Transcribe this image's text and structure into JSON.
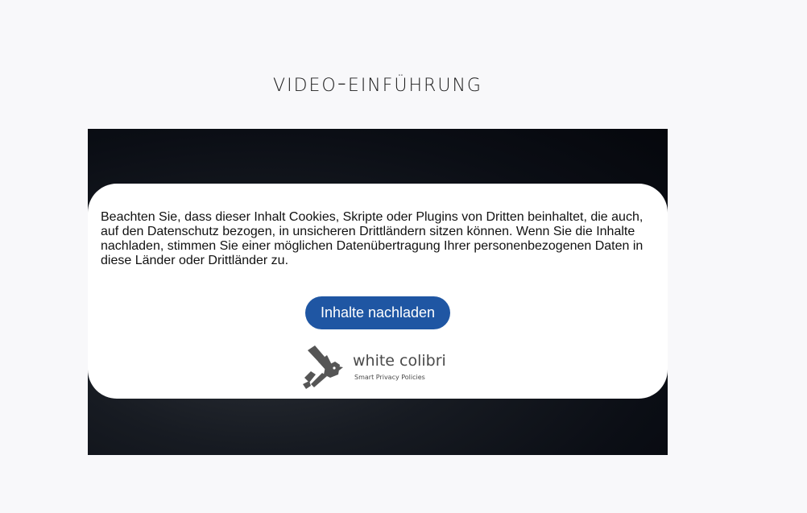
{
  "page": {
    "title": "Video-Einführung"
  },
  "consent": {
    "message": "Beachten Sie, dass dieser Inhalt Cookies, Skripte oder Plugins von Dritten beinhaltet, die auch, auf den Datenschutz bezogen, in unsicheren Drittländern sitzen können. Wenn Sie die Inhalte nachladen, stimmen Sie einer möglichen Datenübertragung Ihrer personenbezogenen Daten in diese Länder oder Drittländer zu.",
    "button_label": "Inhalte nachladen",
    "button_color": "#1f56a3"
  },
  "logo": {
    "name": "white colibri",
    "tagline": "Smart Privacy Policies",
    "icon": "colibri-bird-icon"
  }
}
